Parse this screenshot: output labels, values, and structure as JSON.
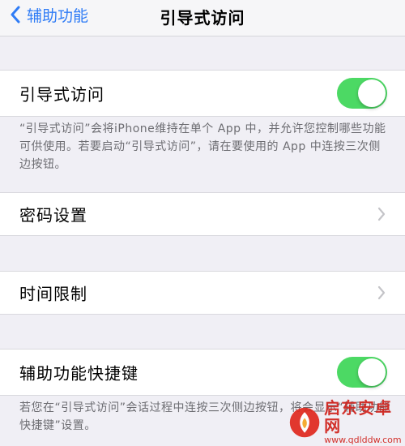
{
  "nav": {
    "back_label": "辅助功能",
    "title": "引导式访问"
  },
  "guided_access": {
    "label": "引导式访问",
    "enabled": true,
    "note": "“引导式访问”会将iPhone维持在单个 App 中，并允许您控制哪些功能可供使用。若要启动“引导式访问”，请在要使用的 App 中连按三次侧边按钮。"
  },
  "passcode": {
    "label": "密码设置"
  },
  "time_limits": {
    "label": "时间限制"
  },
  "accessibility_shortcut": {
    "label": "辅助功能快捷键",
    "enabled": true,
    "note": "若您在“引导式访问”会话过程中连按三次侧边按钮，将会显示“辅助功能快捷键”设置。"
  },
  "watermark": {
    "name": "启东安卓网",
    "url": "www.qdlddw.com"
  },
  "colors": {
    "accent": "#2f7cf6",
    "toggle_on": "#4cd964",
    "background": "#f0eff5"
  },
  "icons": [
    "chevron-left-icon",
    "chevron-right-icon",
    "toggle-switch"
  ]
}
